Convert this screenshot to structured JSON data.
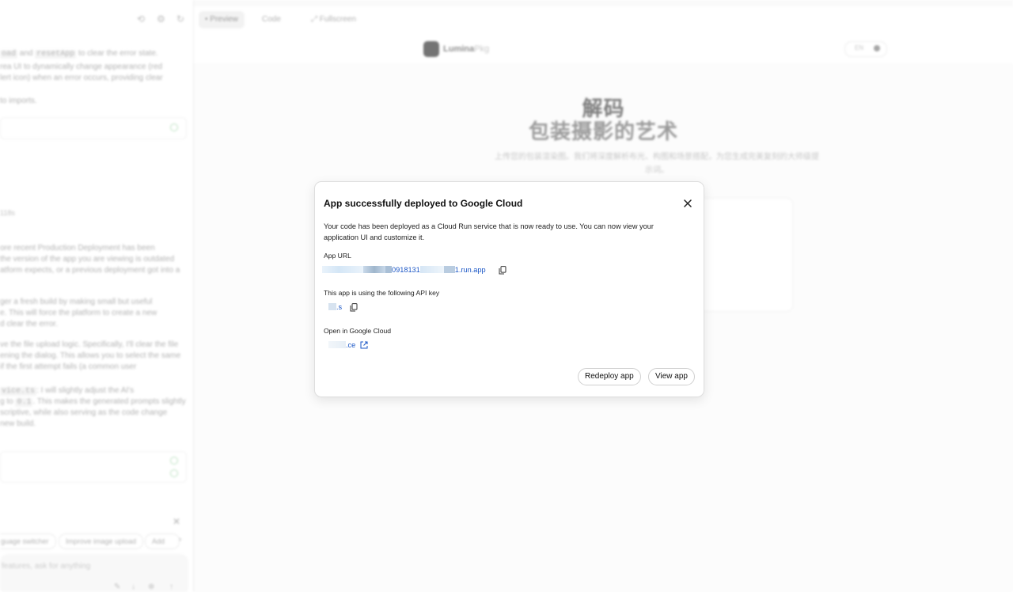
{
  "left_panel": {
    "lines": [
      {
        "chip1": "oad",
        "text1": " and ",
        "chip2": "resetApp",
        "text2": " to clear the error state."
      },
      {
        "text": "rea UI to dynamically change appearance (red"
      },
      {
        "text": "lert icon) when an error occurs, providing clear"
      },
      {
        "text": "to imports."
      }
    ],
    "timestamp": "118s",
    "message_lines": [
      "ore recent Production Deployment has been",
      " the version of the app you are viewing is outdated",
      "atform expects, or a previous deployment got into a",
      "ger a fresh build by making small but useful",
      "e. This will force the platform to create a new",
      "d clear the error.",
      "ve the file upload logic. Specifically, I'll clear the file",
      "ening the dialog. This allows you to select the same",
      " if the first attempt fails (a common user"
    ],
    "service_line": {
      "chip": "vice.ts",
      "text": ": I will slightly adjust the AI's"
    },
    "temp_line": {
      "text1": "g to ",
      "chip": "0.1",
      "text2": ". This makes the generated prompts slightly"
    },
    "tail_lines": [
      "scriptive, while also serving as the code change",
      " new build."
    ],
    "suggestions": [
      "guage switcher",
      "Improve image upload",
      "Add"
    ],
    "prompt_placeholder": "features, ask for anything"
  },
  "toolbar": {
    "tabs": [
      {
        "label": "Preview",
        "active": true
      },
      {
        "label": "Code",
        "active": false
      },
      {
        "label": "Fullscreen",
        "active": false
      }
    ]
  },
  "preview": {
    "brand_main": "Lumina",
    "brand_suffix": "Pkg",
    "toggle_label": "EN",
    "hero_line1": "解码",
    "hero_line2": "包装摄影的艺术",
    "hero_subtitle": "上传您的包装渲染图。我们将深度解析布光、构图和场景搭配，为您生成完美复刻的大师级提示词。"
  },
  "modal": {
    "title": "App successfully deployed to Google Cloud",
    "description": "Your code has been deployed as a Cloud Run service that is now ready to use. You can now view your application UI and customize it.",
    "app_url_label": "App URL",
    "app_url_value": "0918131",
    "app_url_suffix": "1.run.app",
    "api_key_label": "This app is using the following API key",
    "api_key_value": ".s",
    "cloud_label": "Open in Google Cloud",
    "cloud_value": ".ce",
    "redeploy_label": "Redeploy app",
    "view_label": "View app"
  }
}
